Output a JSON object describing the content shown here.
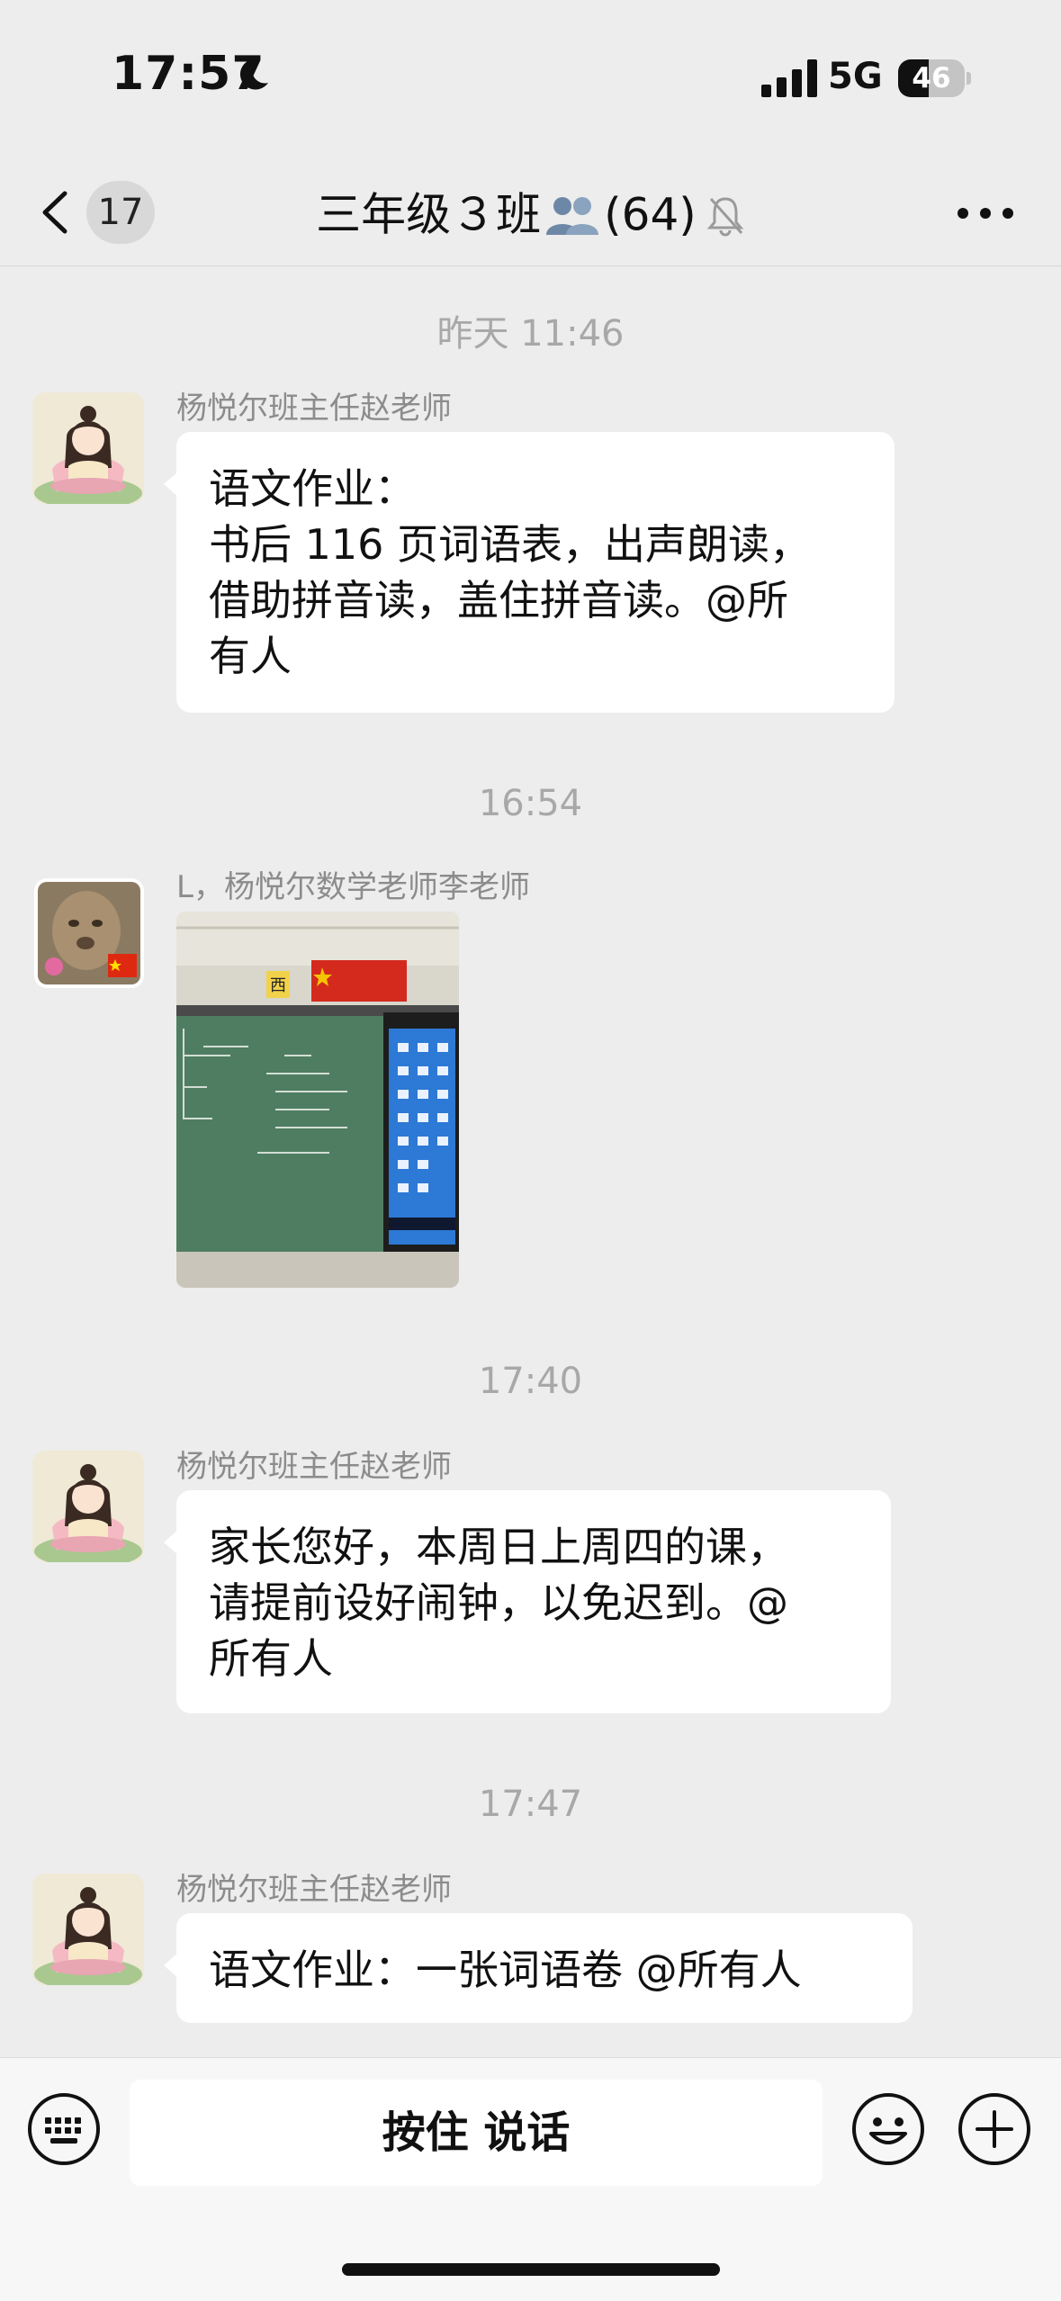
{
  "status_bar": {
    "time": "17:57",
    "network": "5G",
    "battery_level": 46,
    "battery_text": "46",
    "icons": [
      "moon-icon",
      "signal-icon",
      "battery-icon"
    ]
  },
  "nav": {
    "unread_count": "17",
    "title": "三年级３班",
    "member_count": "(64)",
    "icons": [
      "back-chevron-icon",
      "group-icon",
      "mute-bell-icon",
      "more-icon"
    ]
  },
  "messages": [
    {
      "timestamp": "昨天 11:46",
      "sender": "杨悦尔班主任赵老师",
      "type": "text",
      "lines": [
        "语文作业：",
        "书后 116 页词语表，出声朗读，",
        "借助拼音读，盖住拼音读。@所",
        "有人"
      ]
    },
    {
      "timestamp": "16:54",
      "sender": "L，杨悦尔数学老师李老师",
      "type": "image",
      "image_marks": [
        "西"
      ]
    },
    {
      "timestamp": "17:40",
      "sender": "杨悦尔班主任赵老师",
      "type": "text",
      "lines": [
        "家长您好，本周日上周四的课，",
        "请提前设好闹钟，以免迟到。@",
        "所有人"
      ]
    },
    {
      "timestamp": "17:47",
      "sender": "杨悦尔班主任赵老师",
      "type": "text",
      "lines": [
        "语文作业：一张词语卷 @所有人"
      ]
    }
  ],
  "input_bar": {
    "voice_label": "按住 说话",
    "icons": [
      "keyboard-icon",
      "emoji-icon",
      "plus-icon"
    ]
  },
  "colors": {
    "background": "#ededed",
    "bubble": "#ffffff",
    "timestamp": "#a8a8a8",
    "sender": "#8c8c8c",
    "chalkboard": "#4f7d62"
  }
}
